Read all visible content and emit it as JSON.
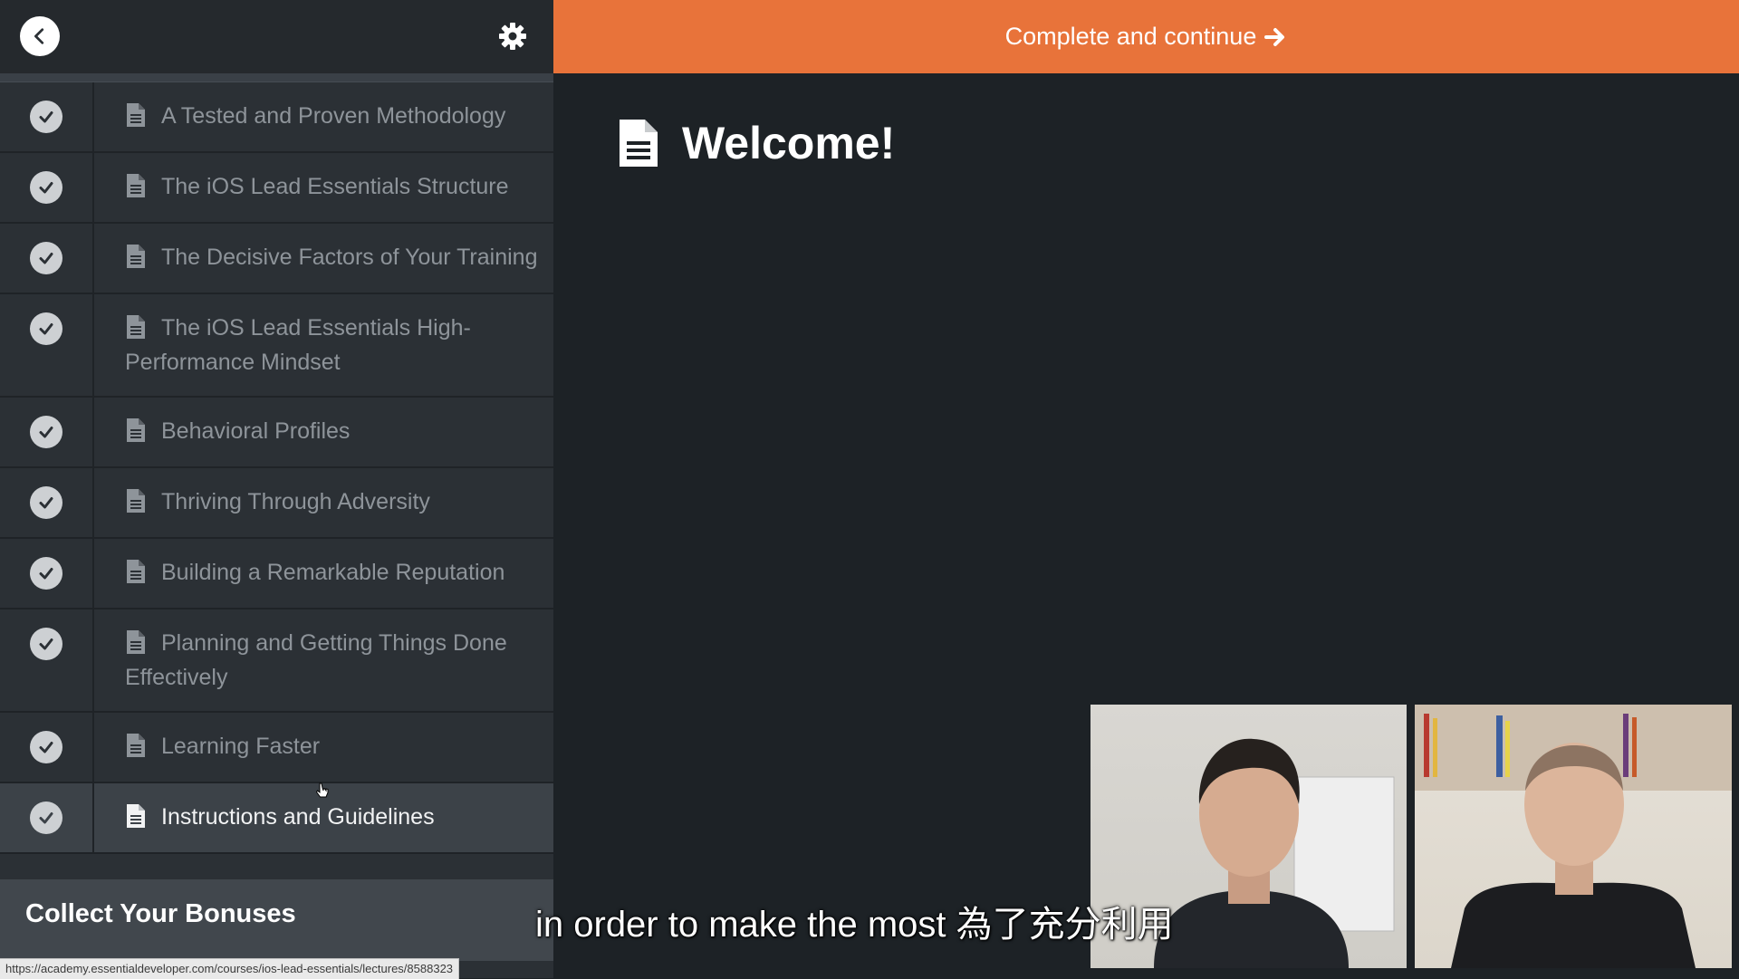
{
  "sidebar": {
    "lessons": [
      {
        "title": "A Tested and Proven Methodology"
      },
      {
        "title": "The iOS Lead Essentials Structure"
      },
      {
        "title": "The Decisive Factors of Your Training"
      },
      {
        "title": "The iOS Lead Essentials High-Performance Mindset"
      },
      {
        "title": "Behavioral Profiles"
      },
      {
        "title": "Thriving Through Adversity"
      },
      {
        "title": "Building a Remarkable Reputation"
      },
      {
        "title": "Planning and Getting Things Done Effectively"
      },
      {
        "title": "Learning Faster"
      },
      {
        "title": "Instructions and Guidelines"
      }
    ],
    "section_title": "Collect Your Bonuses"
  },
  "topbar": {
    "complete_label": "Complete and continue"
  },
  "main": {
    "title": "Welcome!"
  },
  "video": {
    "subtitle": "in order to make the most 為了充分利用"
  },
  "status_bar": {
    "url": "https://academy.essentialdeveloper.com/courses/ios-lead-essentials/lectures/8588323"
  },
  "colors": {
    "accent": "#e8733a",
    "background": "#1d2226",
    "sidebar": "#2b3035"
  },
  "icons": [
    "chevron-left-icon",
    "gear-icon",
    "checkmark-icon",
    "document-icon",
    "arrow-right-icon"
  ]
}
